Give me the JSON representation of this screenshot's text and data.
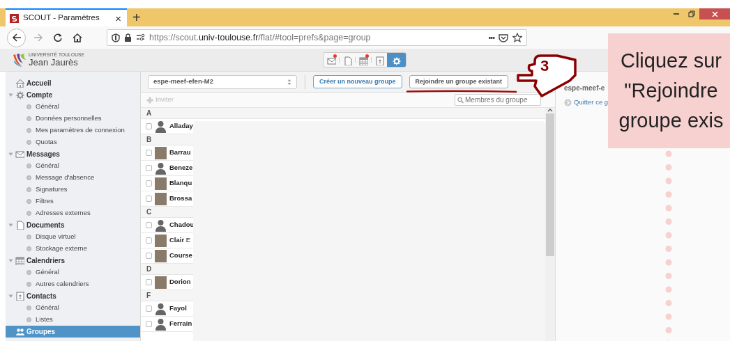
{
  "browser": {
    "tab": {
      "title": "SCOUT - Paramètres",
      "close": "×",
      "selected": true
    },
    "new_tab": "+",
    "url": {
      "scheme": "https://scout.",
      "domain": "univ-toulouse.fr",
      "path": "/flat/#tool=prefs&page=group"
    },
    "more": "•••"
  },
  "logo": {
    "line1": "UNIVERSITÉ TOULOUSE",
    "line2": "Jean Jaurès"
  },
  "app_toolbar": [
    {
      "kind": "mail",
      "selected": false,
      "notified": true
    },
    {
      "kind": "document",
      "selected": false,
      "notified": false
    },
    {
      "kind": "calendar",
      "selected": false,
      "notified": true
    },
    {
      "kind": "contacts",
      "selected": false,
      "notified": false
    },
    {
      "kind": "settings",
      "selected": true,
      "notified": false
    }
  ],
  "sidebar": {
    "items": [
      {
        "kind": "home",
        "label": "Accueil",
        "selected": false
      },
      {
        "kind": "gear",
        "label": "Compte",
        "selected": false,
        "expanded": true,
        "children": [
          {
            "label": "Général",
            "selected": false
          },
          {
            "label": "Données personnelles",
            "selected": false
          },
          {
            "label": "Mes paramètres de connexion",
            "selected": false
          },
          {
            "label": "Quotas",
            "selected": false
          }
        ]
      },
      {
        "kind": "mail",
        "label": "Messages",
        "selected": false,
        "expanded": true,
        "children": [
          {
            "label": "Général",
            "selected": false
          },
          {
            "label": "Message d'absence",
            "selected": false
          },
          {
            "label": "Signatures",
            "selected": false
          },
          {
            "label": "Filtres",
            "selected": false
          },
          {
            "label": "Adresses externes",
            "selected": false
          }
        ]
      },
      {
        "kind": "document",
        "label": "Documents",
        "selected": false,
        "expanded": true,
        "children": [
          {
            "label": "Disque virtuel",
            "selected": false
          },
          {
            "label": "Stockage externe",
            "selected": false
          }
        ]
      },
      {
        "kind": "calendar",
        "label": "Calendriers",
        "selected": false,
        "expanded": true,
        "children": [
          {
            "label": "Général",
            "selected": false
          },
          {
            "label": "Autres calendriers",
            "selected": false
          }
        ]
      },
      {
        "kind": "contacts",
        "label": "Contacts",
        "selected": false,
        "expanded": true,
        "children": [
          {
            "label": "Général",
            "selected": false
          },
          {
            "label": "Listes",
            "selected": false
          }
        ]
      },
      {
        "kind": "groups",
        "label": "Groupes",
        "selected": true
      }
    ]
  },
  "groups": {
    "group_select": "espe-meef-efen-M2",
    "buttons": [
      {
        "kind": "primary",
        "label": "Créer un nouveau groupe"
      },
      {
        "kind": "default",
        "label": "Rejoindre un groupe existant"
      }
    ],
    "invite": {
      "label": "Inviter",
      "disabled": true
    },
    "search": {
      "placeholder": "Membres du groupe"
    },
    "sections": [
      {
        "letter": "A",
        "members": [
          {
            "name": "Alladay",
            "photo": false,
            "checked": false
          }
        ]
      },
      {
        "letter": "B",
        "members": [
          {
            "name": "Barrau",
            "photo": true,
            "checked": false
          },
          {
            "name": "Beneze",
            "photo": false,
            "checked": false
          },
          {
            "name": "Blanqu",
            "photo": true,
            "checked": false
          },
          {
            "name": "Brossa",
            "photo": true,
            "checked": false
          }
        ]
      },
      {
        "letter": "C",
        "members": [
          {
            "name": "Chadou",
            "photo": false,
            "checked": false
          },
          {
            "name": "Clair",
            "first_name": "E",
            "photo": true,
            "checked": false
          },
          {
            "name": "Course",
            "photo": true,
            "checked": false
          }
        ]
      },
      {
        "letter": "D",
        "members": [
          {
            "name": "Dorion",
            "photo": true,
            "checked": false
          }
        ]
      },
      {
        "letter": "F",
        "members": [
          {
            "name": "Fayol",
            "photo": false,
            "checked": false
          },
          {
            "name": "Ferrain",
            "photo": false,
            "checked": false
          }
        ]
      }
    ]
  },
  "details": {
    "title": "espe-meef-e",
    "leave_link": "Quitter ce g"
  },
  "tutorial": {
    "step": "3",
    "callout": [
      "Cliquez sur",
      "\"Rejoindre",
      "groupe exis"
    ]
  }
}
